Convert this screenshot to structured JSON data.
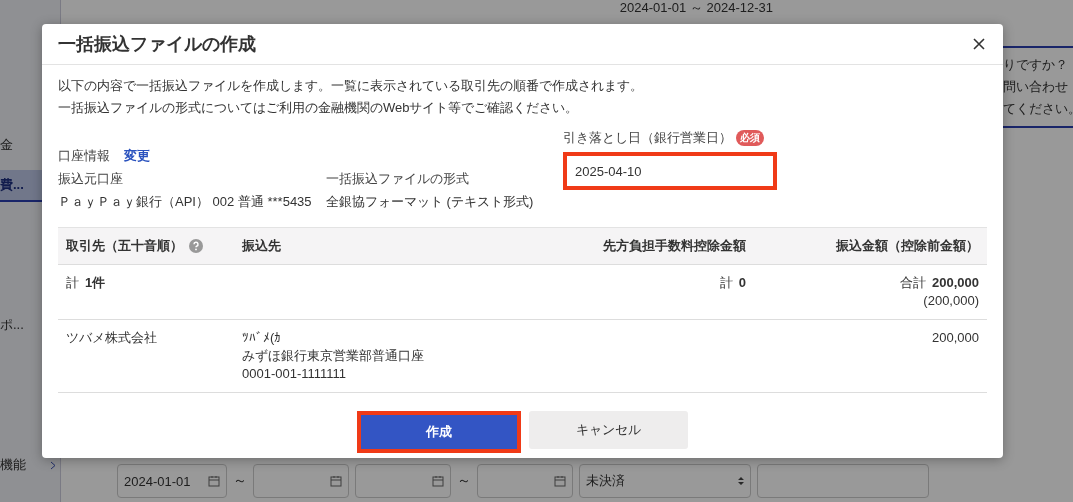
{
  "background": {
    "date_range": "2024-01-01 ～ 2024-12-31",
    "sidebar_items": [
      {
        "label": "金",
        "selected": false
      },
      {
        "label": "費...",
        "selected": true
      },
      {
        "label": "ポ...",
        "selected": false
      },
      {
        "label": "機能",
        "selected": false
      }
    ],
    "notice_lines": [
      "りですか？",
      "問い合わせ",
      "てください。"
    ],
    "filters": [
      {
        "kind": "date",
        "value": "2024-01-01"
      },
      {
        "kind": "separator",
        "text": "～"
      },
      {
        "kind": "date"
      },
      {
        "kind": "date"
      },
      {
        "kind": "separator",
        "text": "～"
      },
      {
        "kind": "date"
      },
      {
        "kind": "select",
        "value": "未決済"
      },
      {
        "kind": "text"
      }
    ]
  },
  "dialog": {
    "title": "一括振込ファイルの作成",
    "description": [
      "以下の内容で一括振込ファイルを作成します。一覧に表示されている取引先の順番で作成されます。",
      "一括振込ファイルの形式についてはご利用の金融機関のWebサイト等でご確認ください。"
    ],
    "account_info": {
      "label": "口座情報",
      "change_link": "変更"
    },
    "source_account": {
      "label": "振込元口座",
      "value": "ＰａｙＰａｙ銀行（API） 002 普通 ***5435"
    },
    "file_format": {
      "label": "一括振込ファイルの形式",
      "value": "全銀協フォーマット (テキスト形式)"
    },
    "debit_date": {
      "label": "引き落とし日（銀行営業日）",
      "required_badge": "必須",
      "value": "2025-04-10"
    },
    "table": {
      "columns": [
        "取引先（五十音順）",
        "振込先",
        "先方負担手数料控除金額",
        "振込金額（控除前金額）"
      ],
      "total": {
        "count_label": "計",
        "count": "1件",
        "fee_label": "計",
        "fee": "0",
        "amount_label": "合計",
        "amount": "200,000",
        "amount_before": "(200,000)"
      },
      "rows": [
        {
          "partner": "ツバメ株式会社",
          "payee_lines": [
            "ﾂﾊﾞﾒ(ｶ",
            "みずほ銀行東京営業部普通口座",
            "0001-001-1111111"
          ],
          "fee": "",
          "amount": "200,000"
        }
      ]
    },
    "buttons": [
      {
        "kind": "primary",
        "label": "作成"
      },
      {
        "kind": "secondary",
        "label": "キャンセル"
      }
    ]
  }
}
